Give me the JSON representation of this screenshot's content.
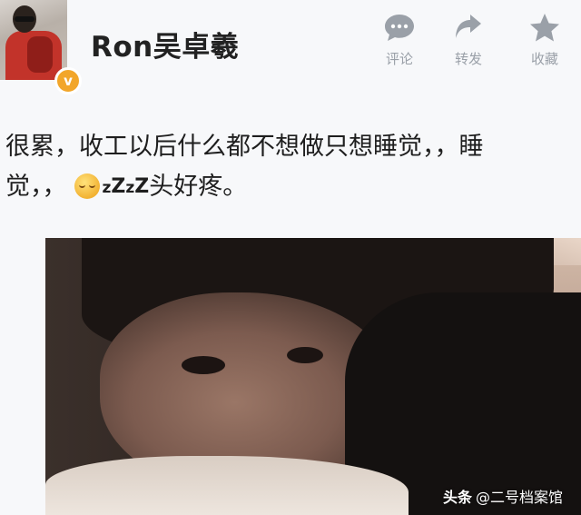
{
  "post": {
    "username": "Ron吴卓羲",
    "verified_badge": "v",
    "text_line1": "很累，收工以后什么都不想做只想睡觉，，睡",
    "text_line2_start": "觉，，",
    "text_zzz": [
      "z",
      "Z",
      "z",
      "Z"
    ],
    "text_line2_end": "头好疼。"
  },
  "actions": {
    "comment_label": "评论",
    "repost_label": "转发",
    "favorite_label": "收藏"
  },
  "watermark": {
    "brand": "头条",
    "handle": "@二号档案馆"
  },
  "icons": {
    "comment": "comment-bubble-icon",
    "repost": "repost-arrow-icon",
    "favorite": "star-icon",
    "emoji": "sleepy-face-emoji"
  },
  "colors": {
    "action_gray": "#9aa0a8",
    "badge_orange": "#f2a62a",
    "text": "#1e1e1e"
  }
}
